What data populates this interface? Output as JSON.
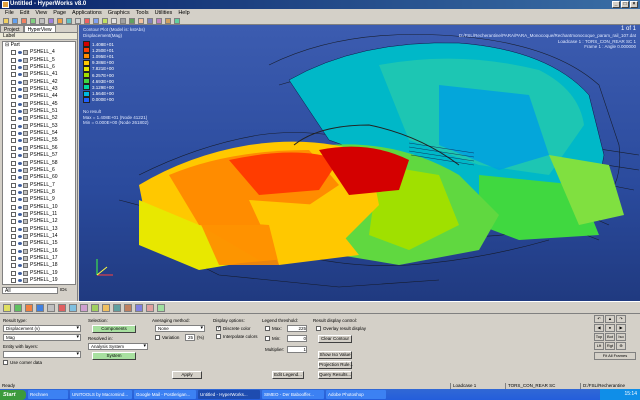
{
  "window": {
    "title": "Untitled - HyperWorks v8.0"
  },
  "menu": [
    "File",
    "Edit",
    "View",
    "Page",
    "Applications",
    "Graphics",
    "Tools",
    "Utilities",
    "Help"
  ],
  "left_panel": {
    "tabs": [
      "Project",
      "HyperView"
    ],
    "label_header": "Label",
    "root": "Part",
    "parts": [
      "PSHELL_4",
      "PSHELL_5",
      "PSHELL_6",
      "PSHELL_41",
      "PSHELL_42",
      "PSHELL_43",
      "PSHELL_44",
      "PSHELL_45",
      "PSHELL_51",
      "PSHELL_52",
      "PSHELL_53",
      "PSHELL_54",
      "PSHELL_55",
      "PSHELL_56",
      "PSHELL_57",
      "PSHELL_58",
      "PSHELL_6",
      "PSHELL_60",
      "PSHELL_7",
      "PSHELL_8",
      "PSHELL_9",
      "PSHELL_10",
      "PSHELL_11",
      "PSHELL_12",
      "PSHELL_13",
      "PSHELL_14",
      "PSHELL_15",
      "PSHELL_16",
      "PSHELL_17",
      "PSHELL_18",
      "PSHELL_19",
      "PSHELL_19",
      "PSHELL_19"
    ],
    "filter": "All",
    "id_label": "IDs"
  },
  "viewport": {
    "info_left": [
      "Contour Plot (Model is: kstAbs)",
      "Displacement(Mag)"
    ],
    "info_right": [
      "D:/FSL/Recherantine/PARA/PARA_Monocoque/Rechantmonocoque_param_rail_107.dat",
      "Loadcase 1 : TORS_CON_REAR SC 1",
      "Frame 1 : Angle 0.000000"
    ],
    "page_indicator": "1 of 1",
    "legend_values": [
      "1.408E+01",
      "1.250E+01",
      "1.095E+01",
      "9.386E+00",
      "7.821E+00",
      "6.257E+00",
      "4.693E+00",
      "3.129E+00",
      "1.564E+00",
      "0.000E+00"
    ],
    "legend_colors": [
      "#d40000",
      "#ff3c00",
      "#ff8c00",
      "#ffc800",
      "#e8e800",
      "#a0e000",
      "#40d840",
      "#00d8a0",
      "#00b8e0",
      "#2060ff"
    ],
    "legend_notes": [
      "No result",
      "Max = 1.408E+01 (Node 41221)",
      "Min = 0.000E+00 (Node 261802)"
    ]
  },
  "controls": {
    "result_type": {
      "title": "Result type:",
      "value": "Displacement (v)",
      "component": "Mag"
    },
    "entity_layers": "Entity with layers:",
    "use_corner_data": "Use corner data",
    "selection": {
      "title": "Selection:",
      "button": "Components",
      "resolved_in": "Resolved in:",
      "system": "Analysis System",
      "system_btn": "System"
    },
    "averaging": {
      "title": "Averaging method:",
      "value": "None",
      "variation": "Variation",
      "variation_val": "25",
      "percent": "(%)"
    },
    "apply_btn": "Apply",
    "display": {
      "title": "Display options:",
      "discrete": "Discrete color",
      "interpolate": "Interpolate colors"
    },
    "legend": {
      "title": "Legend threshold:",
      "max_label": "Max:",
      "max_val": "225",
      "min_label": "Min:",
      "min_val": "0",
      "mult_label": "Multiplier:",
      "mult_val": "1",
      "edit_btn": "Edit Legend..."
    },
    "result_ctrl": {
      "title": "Result display control:",
      "overlay": "Overlay result display",
      "clear": "Clear Contour",
      "show_iso": "Show Iso Value",
      "projection": "Projection Rule...",
      "query": "Query Results..."
    },
    "view": {
      "top": "Top",
      "bot": "Bot",
      "left": "Lft",
      "right": "Rgt",
      "fit": "Fit All Frames",
      "iso": "Iso"
    }
  },
  "status": {
    "left": "Ready",
    "loadcase": "Loadcase 1",
    "case_name": "TORS_CON_REAR SC",
    "path": "D:/FSL/Recherantine"
  },
  "taskbar": {
    "start": "Start",
    "tasks": [
      "Rechnen",
      "UNITOOLS by Macromind...",
      "Google Mail - Postlerigan...",
      "Untitled - HyperWorks...",
      "SIMEO - Der Babooffer...",
      "Adobe Photoshop"
    ],
    "clock": "15:14"
  }
}
